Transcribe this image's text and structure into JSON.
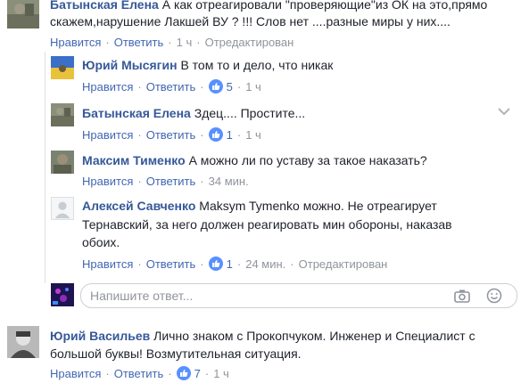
{
  "labels": {
    "like": "Нравится",
    "reply": "Ответить",
    "sep": "·",
    "edited": "Отредактирован"
  },
  "comments": [
    {
      "author": "Батынская Елена",
      "text_line1": "А как отреагировали \"проверяющие\"из ОК на это,прямо",
      "text_line2": "скажем,нарушение Лакшей ВУ ? !!! Слов нет ....разные миры у них....",
      "time": "1 ч"
    },
    {
      "author": "Юрий Мысягин",
      "text_line1": "В том то и дело, что никак",
      "reactions": "5",
      "time": "1 ч"
    },
    {
      "author": "Батынская Елена",
      "text_line1": "Здец.... Простите...",
      "reactions": "1",
      "time": "1 ч"
    },
    {
      "author": "Максим Тименко",
      "text_line1": "А можно ли по уставу за такое наказать?",
      "time": "34 мин."
    },
    {
      "author": "Алексей Савченко",
      "text_line1": "Maksym Tymenko можно. Не отреагирует",
      "text_line2": "Тернавский, за него должен реагировать мин обороны, наказав",
      "text_line3": "обоих.",
      "reactions": "1",
      "time": "24 мин."
    },
    {
      "author": "Юрий Васильев",
      "text_line1": "Лично знаком с Прокопчуком. Инженер и Специалист с",
      "text_line2": "большой буквы! Возмутительная ситуация.",
      "reactions": "7",
      "time": "1 ч"
    }
  ],
  "reply_box": {
    "placeholder": "Напишите ответ..."
  },
  "colors": {
    "link": "#4267b2",
    "name": "#365899",
    "meta": "#90949c",
    "like_badge": "#5890ff"
  }
}
